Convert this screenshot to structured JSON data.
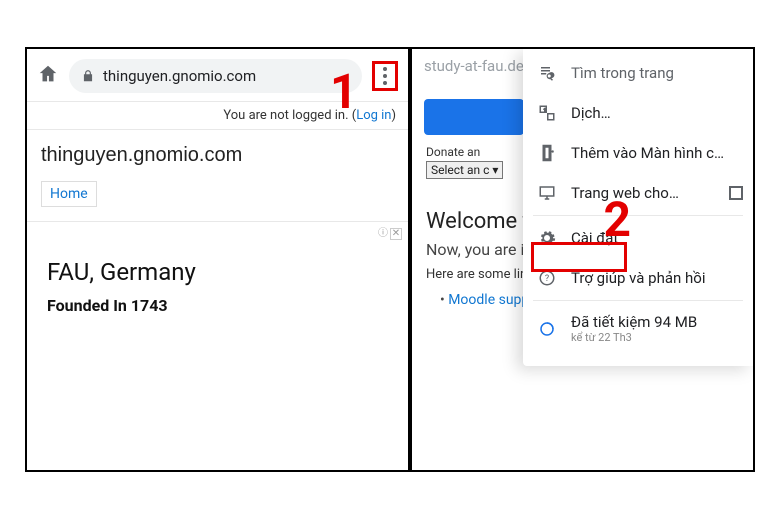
{
  "annotations": {
    "step1": "1",
    "step2": "2"
  },
  "left": {
    "url": "thinguyen.gnomio.com",
    "login_text": "You are not logged in. (",
    "login_link": "Log in",
    "login_close": ")",
    "site_title": "thinguyen.gnomio.com",
    "nav_home": "Home",
    "ad": {
      "title": "FAU, Germany",
      "subtitle": "Founded In 1743",
      "badge": "ⓘ",
      "close": "✕"
    }
  },
  "right": {
    "bg_url": "study-at-fau.de",
    "donate": "Donate an",
    "select": "Select an c",
    "welcome": "Welcome to",
    "now": "Now, you are i",
    "here": "Here are some link",
    "bullet1": "Moodle support site",
    "menu": {
      "find": "Tìm trong trang",
      "translate": "Dịch…",
      "add_home": "Thêm vào Màn hình c…",
      "desktop": "Trang web cho…",
      "settings": "Cài đặt",
      "help": "Trợ giúp và phản hồi",
      "saved_line1": "Đã tiết kiệm 94 MB",
      "saved_line2": "kể từ 22 Th3"
    }
  }
}
